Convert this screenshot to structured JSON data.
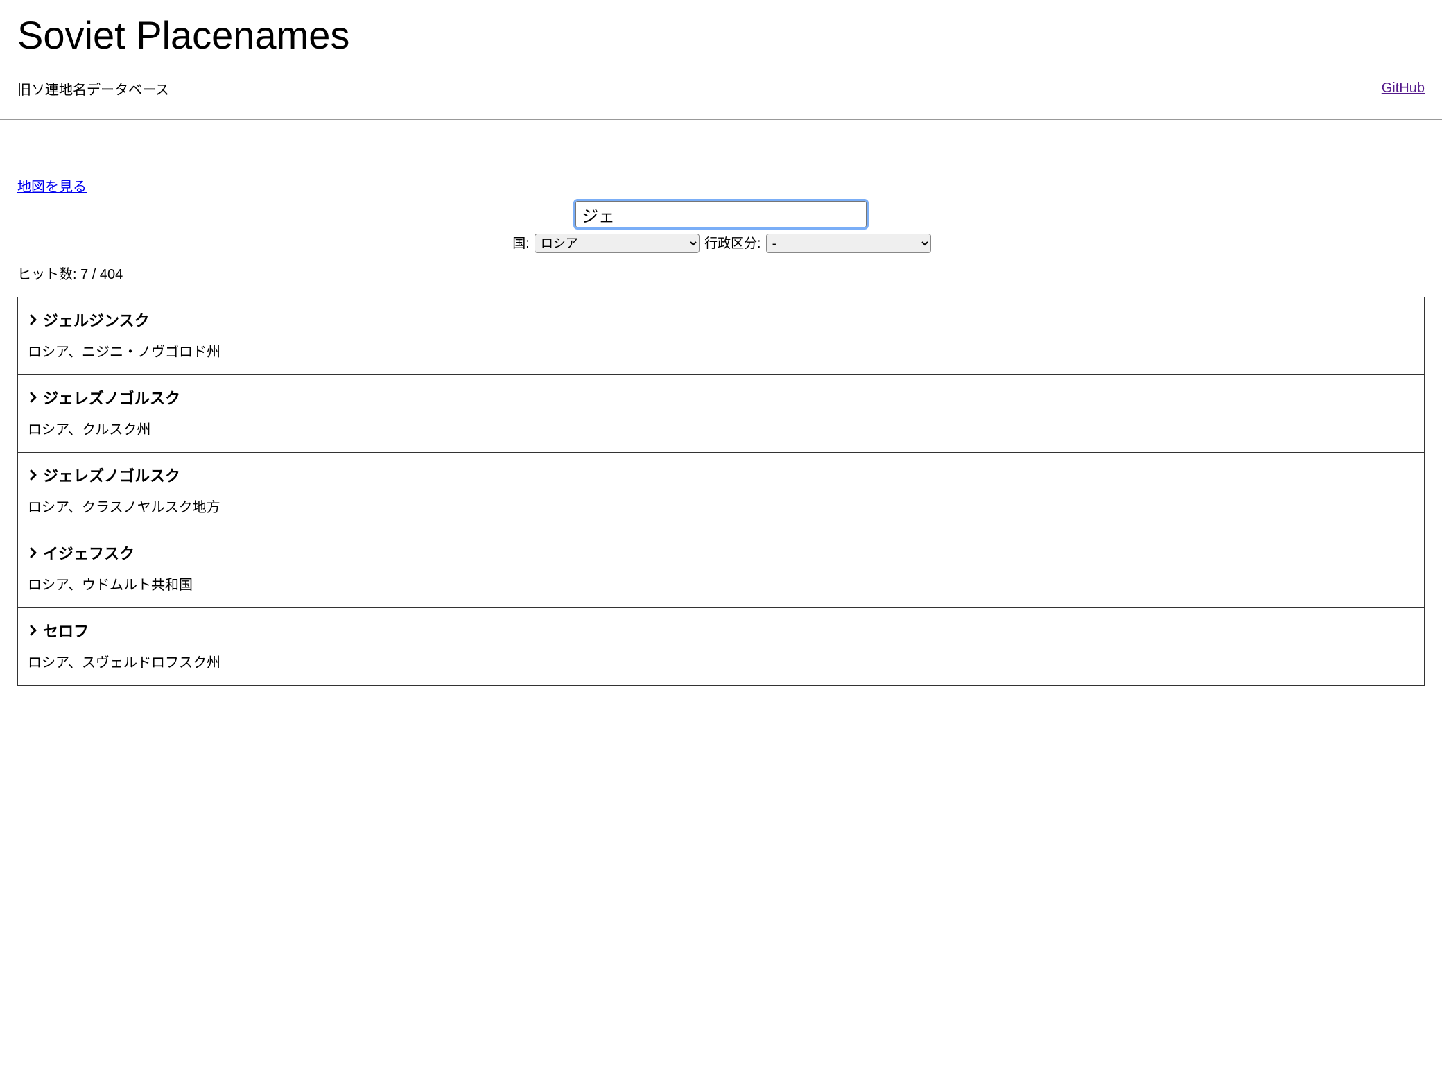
{
  "header": {
    "title": "Soviet Placenames",
    "subtitle": "旧ソ連地名データベース",
    "github_label": "GitHub"
  },
  "links": {
    "map_link": "地図を見る"
  },
  "search": {
    "value": "ジェ"
  },
  "filters": {
    "country_label": "国:",
    "country_value": "ロシア",
    "region_label": "行政区分:",
    "region_value": "-"
  },
  "hit_count": "ヒット数: 7 / 404",
  "results": [
    {
      "title": "ジェルジンスク",
      "location": "ロシア、ニジニ・ノヴゴロド州"
    },
    {
      "title": "ジェレズノゴルスク",
      "location": "ロシア、クルスク州"
    },
    {
      "title": "ジェレズノゴルスク",
      "location": "ロシア、クラスノヤルスク地方"
    },
    {
      "title": "イジェフスク",
      "location": "ロシア、ウドムルト共和国"
    },
    {
      "title": "セロフ",
      "location": "ロシア、スヴェルドロフスク州"
    }
  ]
}
